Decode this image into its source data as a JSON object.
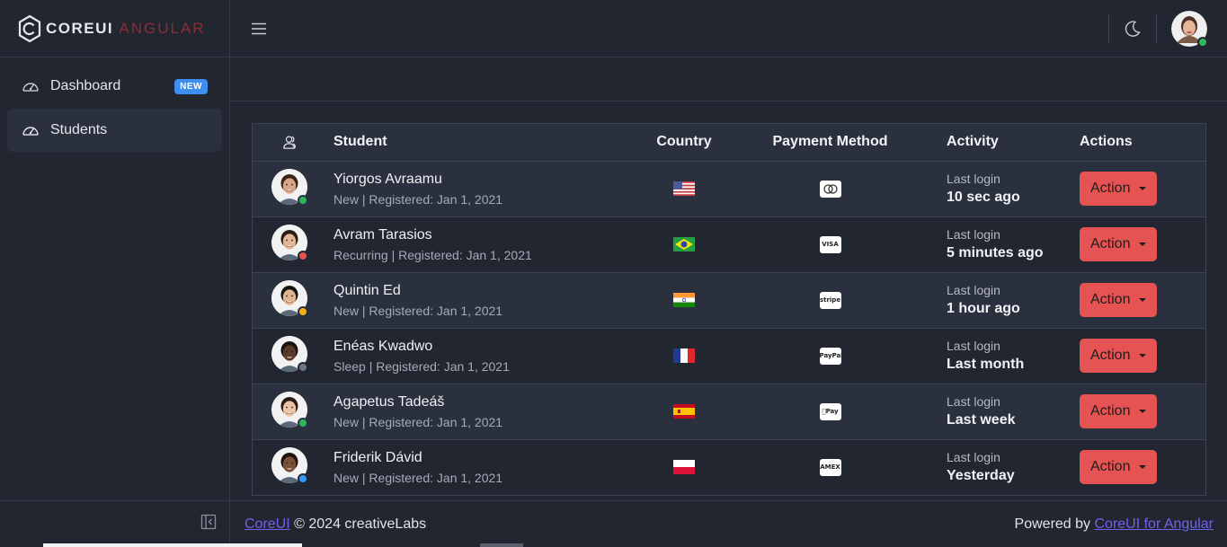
{
  "brand": {
    "core": "COREUI",
    "suffix": "ANGULAR"
  },
  "sidebar": {
    "items": [
      {
        "label": "Dashboard",
        "badge": "NEW",
        "icon": "speedometer-icon"
      },
      {
        "label": "Students",
        "icon": "speedometer-icon",
        "active": true
      }
    ]
  },
  "header": {
    "menu_icon": "hamburger-icon",
    "theme_icon": "moon-icon"
  },
  "table": {
    "columns": [
      "",
      "Student",
      "Country",
      "Payment Method",
      "Activity",
      "Actions"
    ],
    "rows": [
      {
        "name": "Yiorgos Avraamu",
        "meta": "New | Registered: Jan 1, 2021",
        "country": "us",
        "payment": "mastercard",
        "activity_label": "Last login",
        "activity": "10 sec ago",
        "status": "#2eb85c",
        "action": "Action"
      },
      {
        "name": "Avram Tarasios",
        "meta": "Recurring | Registered: Jan 1, 2021",
        "country": "br",
        "payment": "visa",
        "activity_label": "Last login",
        "activity": "5 minutes ago",
        "status": "#e55353",
        "action": "Action"
      },
      {
        "name": "Quintin Ed",
        "meta": "New | Registered: Jan 1, 2021",
        "country": "in",
        "payment": "stripe",
        "activity_label": "Last login",
        "activity": "1 hour ago",
        "status": "#f9b115",
        "action": "Action"
      },
      {
        "name": "Enéas Kwadwo",
        "meta": "Sleep | Registered: Jan 1, 2021",
        "country": "fr",
        "payment": "paypal",
        "activity_label": "Last login",
        "activity": "Last month",
        "status": "#6b7785",
        "action": "Action"
      },
      {
        "name": "Agapetus Tadeáš",
        "meta": "New | Registered: Jan 1, 2021",
        "country": "es",
        "payment": "applepay",
        "activity_label": "Last login",
        "activity": "Last week",
        "status": "#2eb85c",
        "action": "Action"
      },
      {
        "name": "Friderik Dávid",
        "meta": "New | Registered: Jan 1, 2021",
        "country": "pl",
        "payment": "amex",
        "activity_label": "Last login",
        "activity": "Yesterday",
        "status": "#3399ff",
        "action": "Action"
      }
    ]
  },
  "payment_glyphs": {
    "mastercard": "",
    "visa": "VISA",
    "stripe": "stripe",
    "paypal": "PayPal",
    "applepay": "Pay",
    "amex": "AMEX"
  },
  "footer": {
    "left_link": "CoreUI",
    "left_text": " © 2024 creativeLabs",
    "right_text": "Powered by ",
    "right_link": "CoreUI for Angular"
  },
  "colors": {
    "danger": "#e55353",
    "link": "#6f63e9",
    "badge": "#3d8ef0"
  }
}
